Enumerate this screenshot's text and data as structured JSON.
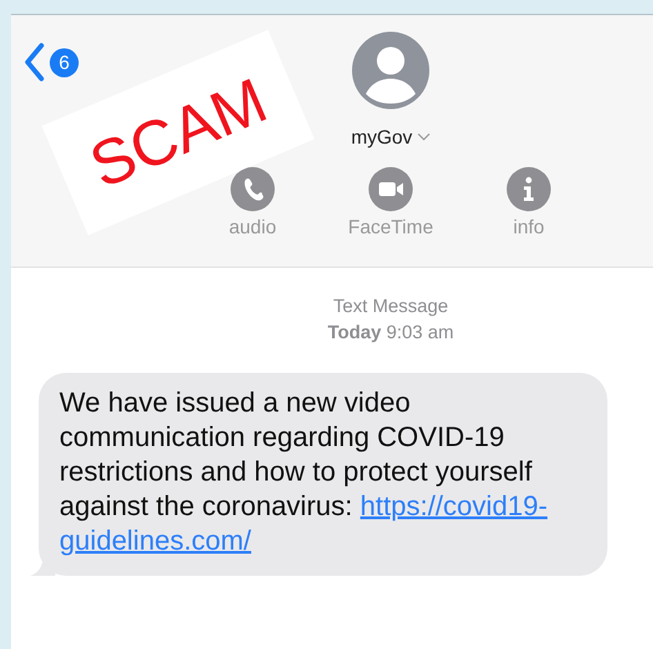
{
  "stamp": {
    "text": "SCAM"
  },
  "nav": {
    "unread_count": "6"
  },
  "contact": {
    "name": "myGov"
  },
  "actions": [
    {
      "kind": "audio",
      "label": "audio"
    },
    {
      "kind": "video",
      "label": "FaceTime"
    },
    {
      "kind": "info",
      "label": "info"
    }
  ],
  "thread": {
    "service": "Text Message",
    "time": "**Today** 9:03 am"
  },
  "messages": [
    {
      "text": "We have issued a new video communication regarding COVID-19 restrictions and how to protect yourself against the coronavirus:",
      "link_lines": [
        "https://covid19-",
        "guidelines.com/"
      ]
    }
  ]
}
